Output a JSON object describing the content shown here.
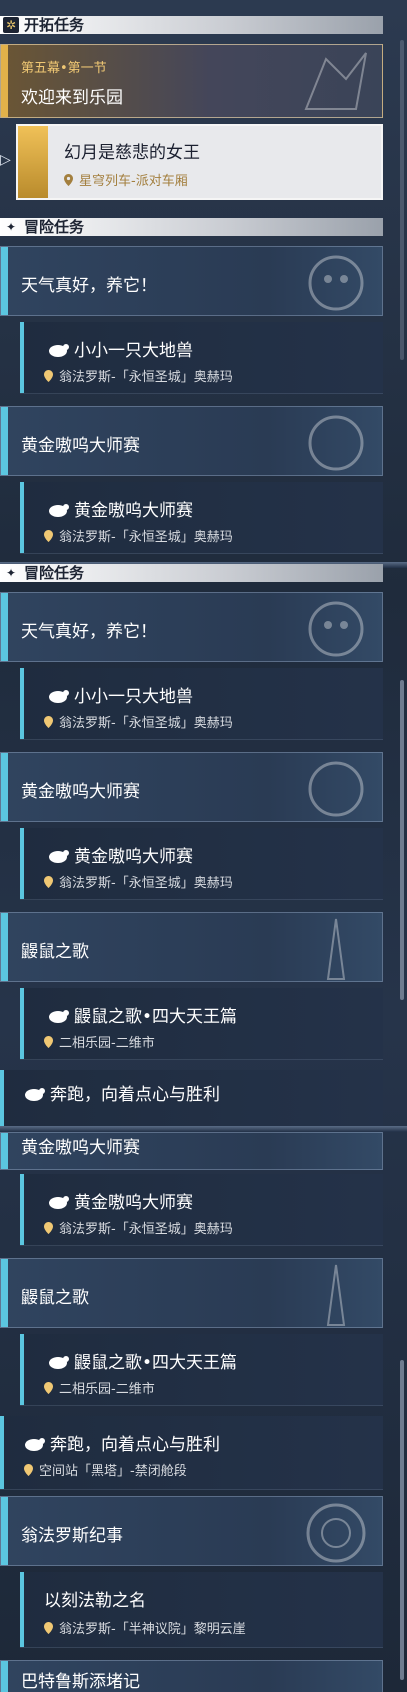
{
  "trailblaze": {
    "header": "开拓任务",
    "chapter": "第五幕•第一节",
    "chapter_title": "欢迎来到乐园",
    "selected_title": "幻月是慈悲的女王",
    "selected_location": "星穹列车-派对车厢"
  },
  "adventure_header": "冒险任务",
  "quests": {
    "q1_title": "天气真好，养它！",
    "q1_sub": "小小一只大地兽",
    "q1_loc": "翁法罗斯-「永恒圣城」奥赫玛",
    "q2_title": "黄金嗷呜大师赛",
    "q2_sub": "黄金嗷呜大师赛",
    "q2_loc": "翁法罗斯-「永恒圣城」奥赫玛",
    "q3_title": "鼹鼠之歌",
    "q3_sub": "鼹鼠之歌•四大天王篇",
    "q3_loc": "二相乐园-二维市",
    "q4_sub": "奔跑，向着点心与胜利",
    "q4_loc": "空间站「黑塔」-禁闭舱段",
    "q5_title": "翁法罗斯纪事",
    "q5_sub": "以刻法勒之名",
    "q5_loc": "翁法罗斯-「半神议院」黎明云崖",
    "q6_title_partial": "巴特鲁斯添堵记"
  },
  "icons": {
    "trailblaze": "sun-emblem-icon",
    "adventure": "diamond-star-icon",
    "pin": "location-pin-icon",
    "bird": "bird-quest-icon"
  },
  "colors": {
    "accent": "#5bc6e0",
    "gold": "#e2b24a",
    "location_gold": "#f0c874"
  }
}
